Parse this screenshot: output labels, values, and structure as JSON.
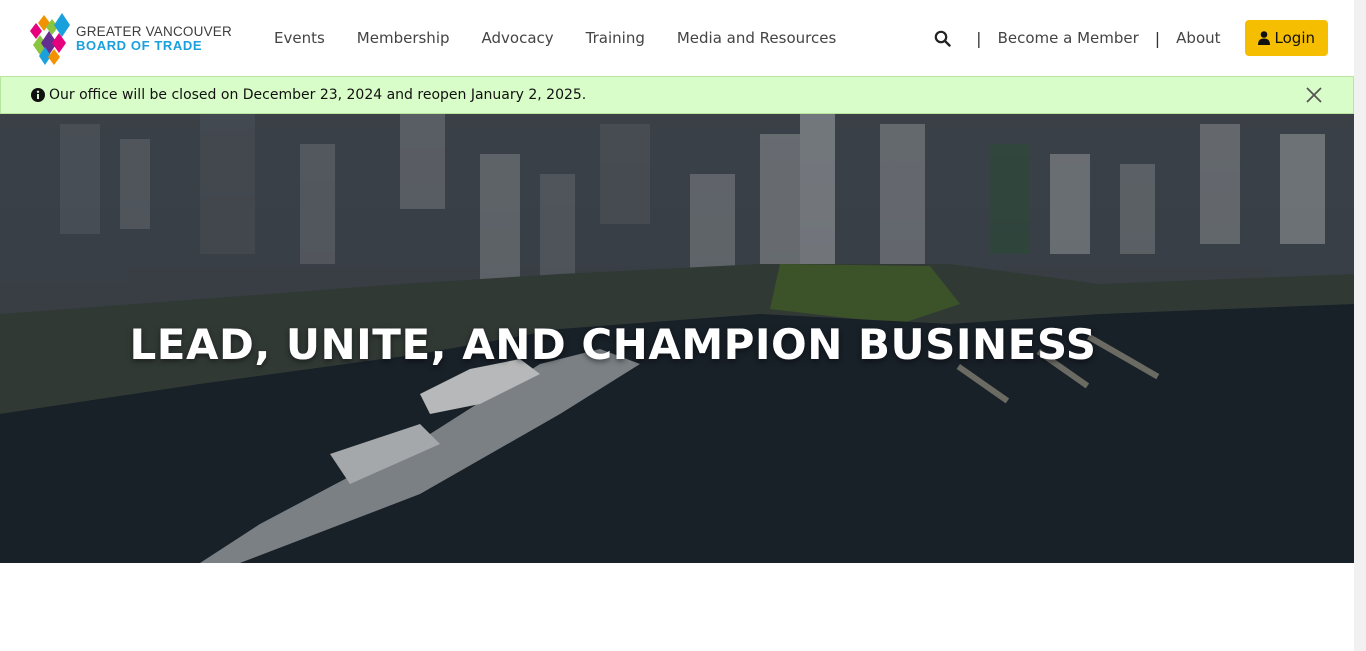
{
  "header": {
    "logo": {
      "line1": "GREATER VANCOUVER",
      "line2": "BOARD OF TRADE"
    },
    "nav": [
      {
        "label": "Events"
      },
      {
        "label": "Membership"
      },
      {
        "label": "Advocacy"
      },
      {
        "label": "Training"
      },
      {
        "label": "Media and Resources"
      }
    ],
    "separator": "|",
    "become_member": "Become a Member",
    "about": "About",
    "login": "Login"
  },
  "alert": {
    "message": "Our office will be closed on December 23, 2024 and reopen January 2, 2025."
  },
  "hero": {
    "title": "LEAD, UNITE, AND CHAMPION BUSINESS"
  },
  "colors": {
    "login_bg": "#f6be00",
    "alert_bg": "#d9fdc8",
    "logo_accent": "#1aa0dc"
  }
}
